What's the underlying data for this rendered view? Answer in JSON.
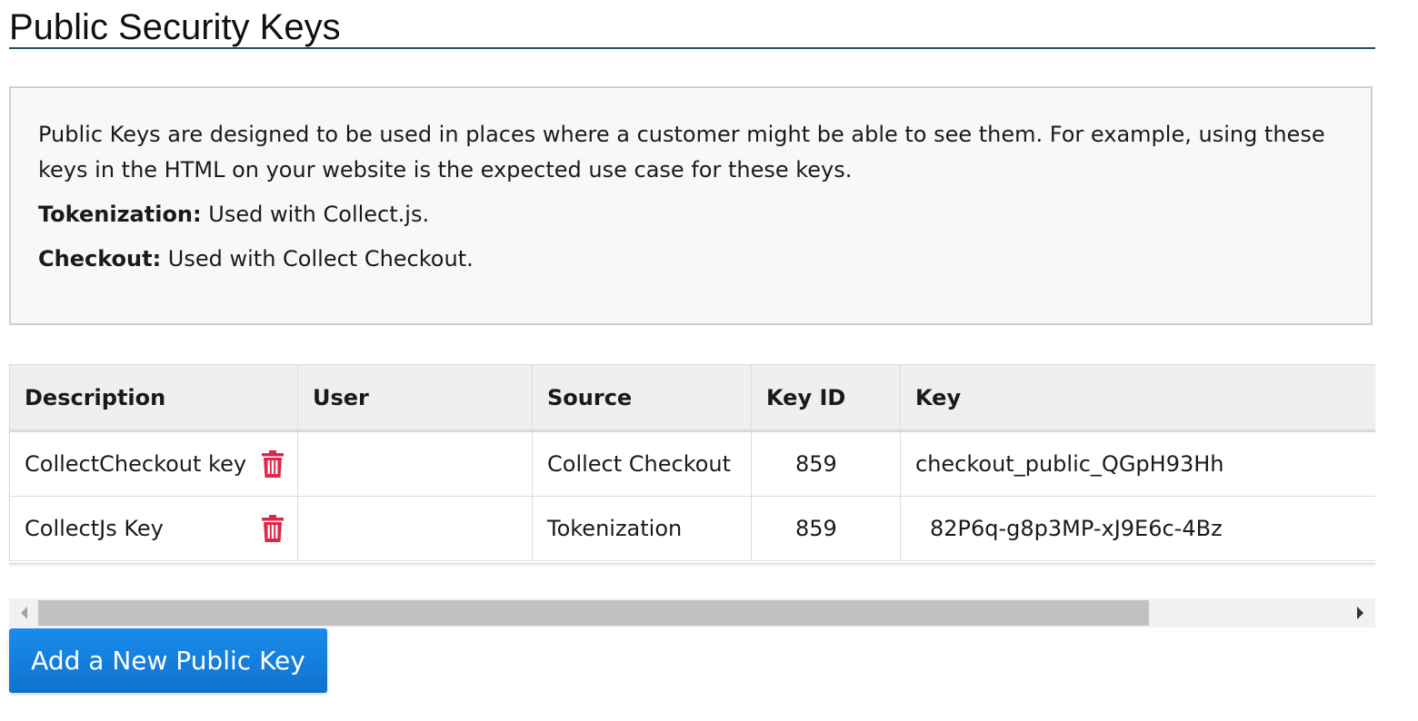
{
  "page": {
    "title": "Public Security Keys"
  },
  "info": {
    "intro": "Public Keys are designed to be used in places where a customer might be able to see them. For example, using these keys in the HTML on your website is the expected use case for these keys.",
    "definitions": [
      {
        "term": "Tokenization:",
        "text": " Used with Collect.js."
      },
      {
        "term": "Checkout:",
        "text": " Used with Collect Checkout."
      }
    ]
  },
  "table": {
    "columns": [
      "Description",
      "User",
      "Source",
      "Key ID",
      "Key"
    ],
    "rows": [
      {
        "description": "CollectCheckout key",
        "user": "",
        "source": "Collect Checkout",
        "key_id": "859",
        "key": "checkout_public_QGpH93Hh"
      },
      {
        "description": "CollectJs Key",
        "user": "",
        "source": "Tokenization",
        "key_id": "859",
        "key": "82P6q-g8p3MP-xJ9E6c-4Bz"
      }
    ]
  },
  "scrollbar": {
    "position_fraction": 0
  },
  "actions": {
    "add_key_label": "Add a New Public Key"
  },
  "colors": {
    "accent_blue": "#1580e0",
    "delete_red": "#e0264b",
    "title_rule": "#1f4e66"
  },
  "icons": {
    "delete": "trash-icon",
    "scroll_left": "arrow-left-icon",
    "scroll_right": "arrow-right-icon"
  }
}
